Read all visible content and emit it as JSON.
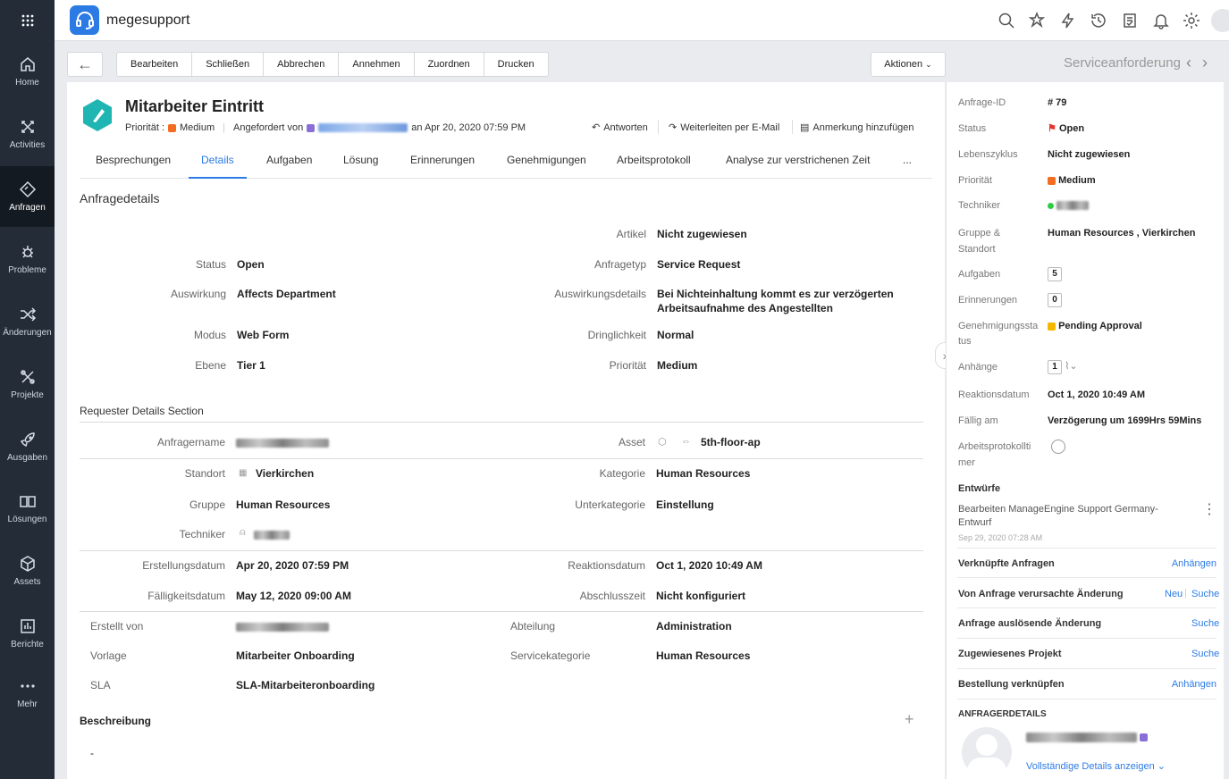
{
  "app": {
    "name": "megesupport"
  },
  "nav": {
    "items": [
      {
        "label": "Home",
        "icon": "home-icon"
      },
      {
        "label": "Activities",
        "icon": "activities-icon"
      },
      {
        "label": "Anfragen",
        "icon": "ticket-icon"
      },
      {
        "label": "Probleme",
        "icon": "bug-icon"
      },
      {
        "label": "Änderungen",
        "icon": "shuffle-icon"
      },
      {
        "label": "Projekte",
        "icon": "projects-icon"
      },
      {
        "label": "Ausgaben",
        "icon": "rocket-icon"
      },
      {
        "label": "Lösungen",
        "icon": "book-icon"
      },
      {
        "label": "Assets",
        "icon": "cube-icon"
      },
      {
        "label": "Berichte",
        "icon": "chart-icon"
      },
      {
        "label": "Mehr",
        "icon": "more-icon"
      }
    ]
  },
  "toolbar": {
    "buttons": [
      "Bearbeiten",
      "Schließen",
      "Abbrechen",
      "Annehmen",
      "Zuordnen",
      "Drucken"
    ],
    "actions": "Aktionen",
    "page_type": "Serviceanforderung"
  },
  "request": {
    "title": "Mitarbeiter Eintritt",
    "priority_label": "Priorität :",
    "priority": "Medium",
    "requested_by_label": "Angefordert von",
    "requested_on": "an Apr 20, 2020 07:59 PM",
    "reply": "Antworten",
    "forward": "Weiterleiten per E-Mail",
    "add_note": "Anmerkung hinzufügen"
  },
  "tabs": [
    "Besprechungen",
    "Details",
    "Aufgaben",
    "Lösung",
    "Erinnerungen",
    "Genehmigungen",
    "Arbeitsprotokoll",
    "Analyse zur verstrichenen Zeit",
    "..."
  ],
  "details": {
    "title": "Anfragedetails",
    "artikel_label": "Artikel",
    "artikel": "Nicht zugewiesen",
    "status_label": "Status",
    "status": "Open",
    "anfragetyp_label": "Anfragetyp",
    "anfragetyp": "Service Request",
    "auswirkung_label": "Auswirkung",
    "auswirkung": "Affects Department",
    "auswirkungsdetails_label": "Auswirkungsdetails",
    "auswirkungsdetails_1": "Bei Nichteinhaltung kommt es zur verzögerten",
    "auswirkungsdetails_2": "Arbeitsaufnahme des Angestellten",
    "modus_label": "Modus",
    "modus": "Web Form",
    "dringlichkeit_label": "Dringlichkeit",
    "dringlichkeit": "Normal",
    "ebene_label": "Ebene",
    "ebene": "Tier 1",
    "prioritaet_label": "Priorität",
    "prioritaet": "Medium"
  },
  "requester": {
    "title": "Requester Details Section",
    "name_label": "Anfragername",
    "asset_label": "Asset",
    "asset": "5th-floor-ap",
    "standort_label": "Standort",
    "standort": "Vierkirchen",
    "kategorie_label": "Kategorie",
    "kategorie": "Human Resources",
    "gruppe_label": "Gruppe",
    "gruppe": "Human Resources",
    "unterkategorie_label": "Unterkategorie",
    "unterkategorie": "Einstellung",
    "techniker_label": "Techniker",
    "erstellungsdatum_label": "Erstellungsdatum",
    "erstellungsdatum": "Apr 20, 2020 07:59 PM",
    "reaktionsdatum_label": "Reaktionsdatum",
    "reaktionsdatum": "Oct 1, 2020 10:49 AM",
    "faelligkeitsdatum_label": "Fälligkeitsdatum",
    "faelligkeitsdatum": "May 12, 2020 09:00 AM",
    "abschlusszeit_label": "Abschlusszeit",
    "abschlusszeit": "Nicht konfiguriert",
    "erstellt_von_label": "Erstellt von",
    "abteilung_label": "Abteilung",
    "abteilung": "Administration",
    "vorlage_label": "Vorlage",
    "vorlage": "Mitarbeiter Onboarding",
    "servicekategorie_label": "Servicekategorie",
    "servicekategorie": "Human Resources",
    "sla_label": "SLA",
    "sla": "SLA-Mitarbeiteronboarding",
    "beschreibung_label": "Beschreibung",
    "beschreibung": "-"
  },
  "side": {
    "id_label": "Anfrage-ID",
    "id": "# 79",
    "status_label": "Status",
    "status": "Open",
    "lifecycle_label": "Lebenszyklus",
    "lifecycle": "Nicht zugewiesen",
    "priority_label": "Priorität",
    "priority": "Medium",
    "technician_label": "Techniker",
    "group_label_1": "Gruppe &",
    "group_label_2": "Standort",
    "group": "Human Resources , Vierkirchen",
    "tasks_label": "Aufgaben",
    "tasks": "5",
    "reminders_label": "Erinnerungen",
    "reminders": "0",
    "approval_label_1": "Genehmigungssta",
    "approval_label_2": "tus",
    "approval": "Pending Approval",
    "attachments_label": "Anhänge",
    "attachments": "1",
    "response_label": "Reaktionsdatum",
    "response": "Oct 1, 2020 10:49 AM",
    "due_label": "Fällig am",
    "due": "Verzögerung um 1699Hrs 59Mins",
    "worklog_label_1": "Arbeitsprotokollti",
    "worklog_label_2": "mer",
    "drafts_title": "Entwürfe",
    "draft_1": "Bearbeiten ManageEngine Support Germany-",
    "draft_2": "Entwurf",
    "draft_date": "Sep 29, 2020 07:28 AM",
    "linked_title": "Verknüpfte Anfragen",
    "linked_action": "Anhängen",
    "caused_title": "Von Anfrage verursachte Änderung",
    "caused_new": "Neu",
    "caused_search": "Suche",
    "trigger_title": "Anfrage auslösende Änderung",
    "trigger_search": "Suche",
    "project_title": "Zugewiesenes Projekt",
    "project_search": "Suche",
    "order_title": "Bestellung verknüpfen",
    "order_action": "Anhängen",
    "requester_title": "ANFRAGERDETAILS",
    "full_details": "Vollständige Details anzeigen"
  },
  "colors": {
    "accent": "#2c7be5",
    "medium": "#f26d21",
    "open": "#e5322d",
    "pending": "#f5b800",
    "nav": "#232c37",
    "green": "#2ecc40"
  }
}
